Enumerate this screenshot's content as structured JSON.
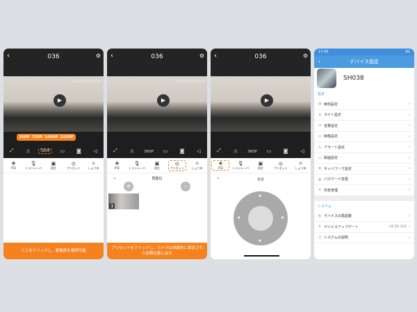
{
  "screen1": {
    "title": "036",
    "timestamp": "2024/05/16 10:20:00",
    "resolutions": [
      "360P",
      "720P",
      "1440P",
      "1920P"
    ],
    "current_res": "360P",
    "tabs": [
      "PTZ",
      "トランシーバ",
      "再生",
      "プリセット",
      "しょうめ"
    ],
    "caption": "ここをクリックし、解像度を選択可能"
  },
  "screen2": {
    "title": "036",
    "timestamp": "2024/05/16 11:20:00",
    "res": "360P",
    "tabs": [
      "PTZ",
      "トランシーバ",
      "再生",
      "プリセット",
      "しょうめ"
    ],
    "section": "預置位",
    "add": "+",
    "remove": "-",
    "preset_num": "1",
    "caption": "プリセットをクリックし、カメラは自動的に設定された初期位置に戻れ"
  },
  "screen3": {
    "title": "036",
    "res": "360P",
    "tabs": [
      "PTZ",
      "トランシーバ",
      "再生",
      "プリセット",
      "しょうめ"
    ],
    "section": "云台"
  },
  "screen4": {
    "time": "17:45",
    "status_icons": "5G",
    "title": "デバイス設定",
    "device": "SH038",
    "settings_label": "設定",
    "settings": [
      {
        "icon": "clock",
        "label": "時刻設定"
      },
      {
        "icon": "bulb",
        "label": "ライト設定"
      },
      {
        "icon": "speaker",
        "label": "音量設定"
      },
      {
        "icon": "video",
        "label": "映像設定"
      },
      {
        "icon": "alert",
        "label": "アラート設定"
      },
      {
        "icon": "record",
        "label": "録画設定"
      },
      {
        "icon": "wifi",
        "label": "ネットワーク設定"
      },
      {
        "icon": "lock",
        "label": "パスワード変更"
      },
      {
        "icon": "share",
        "label": "共有管理"
      }
    ],
    "system_label": "システム",
    "system": [
      {
        "label": "デバイスの再起動",
        "value": ""
      },
      {
        "label": "デバイスアップデート",
        "value": "v9.30.102"
      },
      {
        "label": "システムの説明",
        "value": ""
      }
    ]
  }
}
